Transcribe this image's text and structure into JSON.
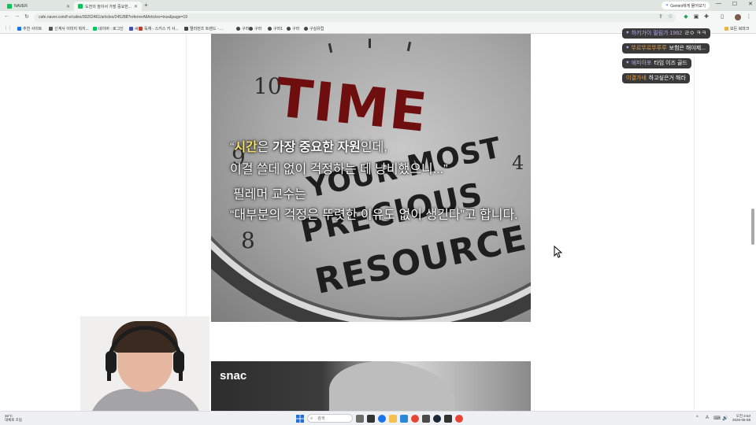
{
  "browser": {
    "tabs": [
      {
        "label": "NAVER",
        "favicon_color": "#03c75a",
        "active": false
      },
      {
        "label": "도전의 높이서 가장 중요한...",
        "favicon_color": "#03c75a",
        "active": true
      }
    ],
    "new_tab": "+",
    "gemini_label": "Gemini에게 물어보기",
    "window_controls": [
      "—",
      "☐",
      "✕"
    ],
    "nav": {
      "back": "←",
      "forward": "→",
      "reload": "↻"
    },
    "url": "cafe.naver.com/f-e/cafes/30202461/articles/245288?referrerAllArticles=true&page=19",
    "icons": [
      "bookmark-star-icon",
      "extensions-icon",
      "downloads-icon",
      "sidepanel-icon",
      "profile-icon",
      "menu-icon"
    ]
  },
  "bookmarks": {
    "items": [
      {
        "label": "추천 사이트",
        "color": "#1a73e8"
      },
      {
        "label": "신계사 이미지 뭐지...",
        "color": "#555555"
      },
      {
        "label": "네이버 : 로그인",
        "color": "#03c75a"
      },
      {
        "label": "씨네",
        "color": "#3f51b5"
      },
      {
        "label": "독재 - 스키스 키 사...",
        "color": "#c0392b"
      },
      {
        "label": "엘리먼츠 트렌드 - ...",
        "color": "#444444"
      },
      {
        "label": "구라",
        "color": "#444444"
      },
      {
        "label": "구라",
        "color": "#444444"
      },
      {
        "label": "구라1",
        "color": "#444444"
      },
      {
        "label": "구라",
        "color": "#444444"
      },
      {
        "label": "구라2",
        "color": "#444444"
      },
      {
        "label": "구실유럽",
        "color": "#444444"
      }
    ],
    "all_bookmarks": "모든 북마크"
  },
  "article": {
    "image1": {
      "clock_numbers": [
        "10",
        "9",
        "8",
        "4"
      ],
      "big_word": "TIME",
      "big_lines": [
        "YOUR MOST",
        "PRECIOUS",
        "RESOURCE"
      ],
      "caption": {
        "line1_open": "“",
        "line1_hl": "시간",
        "line1_mid": "은 ",
        "line1_bold": "가장 중요한 자원",
        "line1_end": "인데,",
        "line2": "이걸 쓸데 없이 걱정하는 데 낭비했으니...”",
        "line3": "필레머 교수는",
        "line4": "“대부분의 걱정은 뚜렷한 이유도 없이 생긴다”고 합니다."
      }
    },
    "image2": {
      "logo": "snac"
    }
  },
  "chat": [
    {
      "user": "하키가이 필림가 1982",
      "message": "ㄹㅇ ㅋㅋ",
      "name_color": "#b9a7e8"
    },
    {
      "user": "뚜르뚜르뚜루루",
      "message": "보험은 해야제...",
      "name_color": "#e8a14a"
    },
    {
      "user": "에피아포",
      "message": "타임 이즈 골드",
      "name_color": "#b9a7e8"
    },
    {
      "user": "이결가네",
      "message": "하고싶은거 해라",
      "name_color": "#e8a14a"
    }
  ],
  "taskbar": {
    "weather_temp": "26°C",
    "weather_desc": "대체로 흐림",
    "search_placeholder": "검색",
    "time": "오전 2:53",
    "date": "2026-05-08",
    "tray": [
      "^",
      "A",
      "⌨",
      "🔊"
    ]
  }
}
